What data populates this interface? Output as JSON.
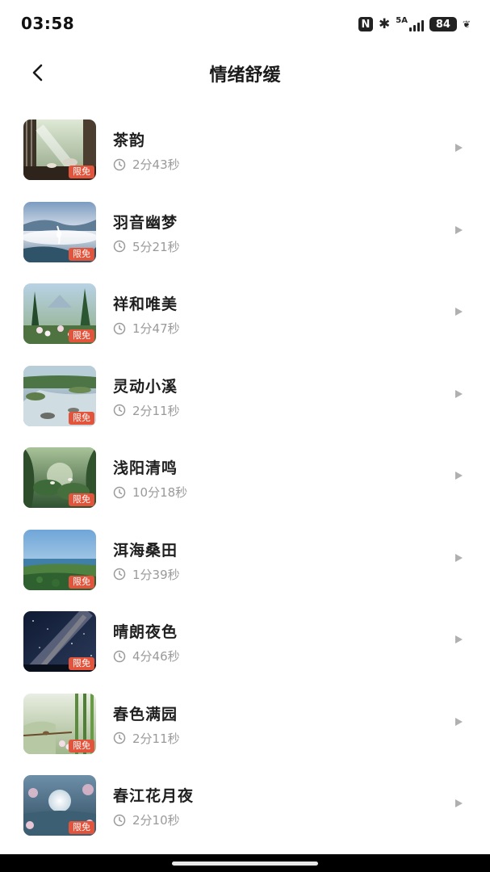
{
  "status_bar": {
    "time": "03:58",
    "network": "5A",
    "battery": "84"
  },
  "header": {
    "title": "情绪舒缓"
  },
  "items": [
    {
      "title": "茶韵",
      "duration": "2分43秒",
      "badge": "限免",
      "scene": "tea-room"
    },
    {
      "title": "羽音幽梦",
      "duration": "5分21秒",
      "badge": "限免",
      "scene": "crane-mist"
    },
    {
      "title": "祥和唯美",
      "duration": "1分47秒",
      "badge": "限免",
      "scene": "forest-flowers"
    },
    {
      "title": "灵动小溪",
      "duration": "2分11秒",
      "badge": "限免",
      "scene": "stream"
    },
    {
      "title": "浅阳清鸣",
      "duration": "10分18秒",
      "badge": "限免",
      "scene": "forest-birds"
    },
    {
      "title": "洱海桑田",
      "duration": "1分39秒",
      "badge": "限免",
      "scene": "lake-fields"
    },
    {
      "title": "晴朗夜色",
      "duration": "4分46秒",
      "badge": "限免",
      "scene": "night-sky"
    },
    {
      "title": "春色满园",
      "duration": "2分11秒",
      "badge": "限免",
      "scene": "bamboo-birds"
    },
    {
      "title": "春江花月夜",
      "duration": "2分10秒",
      "badge": "限免",
      "scene": "moon-river"
    }
  ]
}
